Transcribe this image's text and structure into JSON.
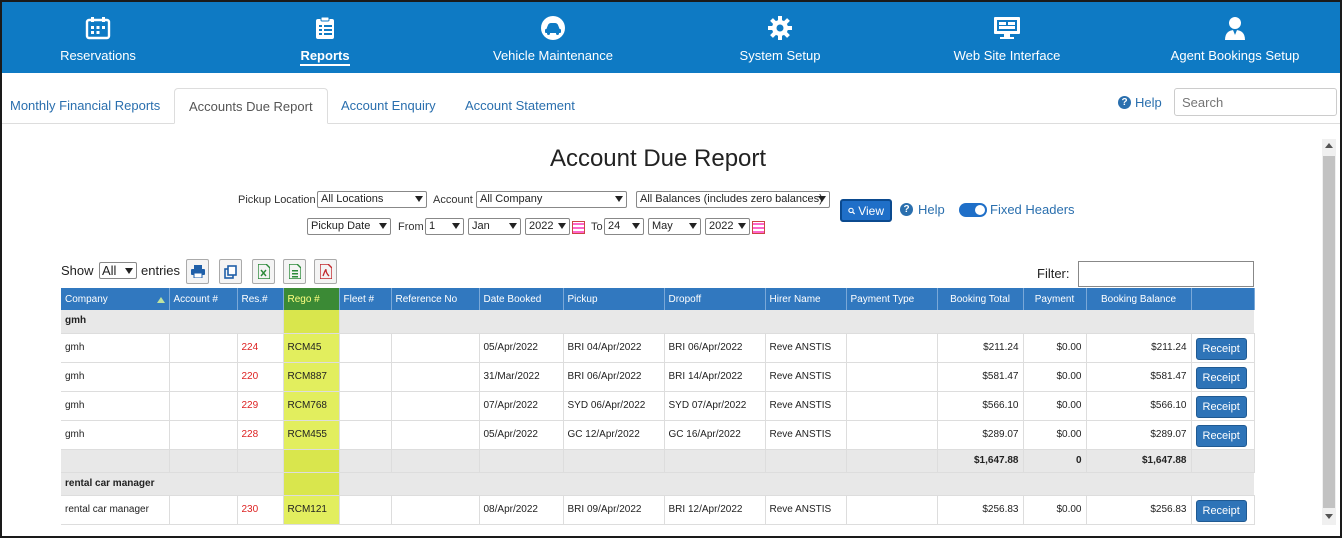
{
  "nav": {
    "items": [
      {
        "label": "Reservations",
        "icon": "calendar-icon"
      },
      {
        "label": "Reports",
        "icon": "clipboard-icon"
      },
      {
        "label": "Vehicle Maintenance",
        "icon": "car-icon"
      },
      {
        "label": "System Setup",
        "icon": "gear-icon"
      },
      {
        "label": "Web Site Interface",
        "icon": "monitor-icon"
      },
      {
        "label": "Agent Bookings Setup",
        "icon": "agent-icon"
      }
    ]
  },
  "tabs": [
    {
      "label": "Monthly Financial Reports"
    },
    {
      "label": "Accounts Due Report"
    },
    {
      "label": "Account Enquiry"
    },
    {
      "label": "Account Statement"
    }
  ],
  "top_help": "Help",
  "search": {
    "placeholder": "Search"
  },
  "title": "Account Due Report",
  "filters": {
    "pickup_location_label": "Pickup Location",
    "pickup_location": "All Locations",
    "account_label": "Account",
    "account": "All Company",
    "balances": "All Balances (includes zero balances)",
    "date_type": "Pickup Date",
    "from_label": "From",
    "from_day": "1",
    "from_month": "Jan",
    "from_year": "2022",
    "to_label": "To",
    "to_day": "24",
    "to_month": "May",
    "to_year": "2022",
    "view_label": "View",
    "help_label": "Help",
    "fixed_headers_label": "Fixed Headers"
  },
  "table_controls": {
    "show_label": "Show",
    "show_value": "All",
    "entries_label": "entries",
    "filter_label": "Filter:"
  },
  "table": {
    "headers": [
      "Company",
      "Account #",
      "Res.#",
      "Rego #",
      "Fleet #",
      "Reference No",
      "Date Booked",
      "Pickup",
      "Dropoff",
      "Hirer Name",
      "Payment Type",
      "Booking Total",
      "Payment",
      "Booking Balance",
      ""
    ],
    "groups": [
      {
        "name": "gmh",
        "rows": [
          {
            "company": "gmh",
            "account": "",
            "res": "224",
            "rego": "RCM45",
            "fleet": "",
            "ref": "",
            "booked": "05/Apr/2022",
            "pickup": "BRI 04/Apr/2022",
            "dropoff": "BRI 06/Apr/2022",
            "hirer": "Reve ANSTIS",
            "ptype": "",
            "total": "$211.24",
            "payment": "$0.00",
            "balance": "$211.24",
            "action": "Receipt"
          },
          {
            "company": "gmh",
            "account": "",
            "res": "220",
            "rego": "RCM887",
            "fleet": "",
            "ref": "",
            "booked": "31/Mar/2022",
            "pickup": "BRI 06/Apr/2022",
            "dropoff": "BRI 14/Apr/2022",
            "hirer": "Reve ANSTIS",
            "ptype": "",
            "total": "$581.47",
            "payment": "$0.00",
            "balance": "$581.47",
            "action": "Receipt"
          },
          {
            "company": "gmh",
            "account": "",
            "res": "229",
            "rego": "RCM768",
            "fleet": "",
            "ref": "",
            "booked": "07/Apr/2022",
            "pickup": "SYD 06/Apr/2022",
            "dropoff": "SYD 07/Apr/2022",
            "hirer": "Reve ANSTIS",
            "ptype": "",
            "total": "$566.10",
            "payment": "$0.00",
            "balance": "$566.10",
            "action": "Receipt"
          },
          {
            "company": "gmh",
            "account": "",
            "res": "228",
            "rego": "RCM455",
            "fleet": "",
            "ref": "",
            "booked": "05/Apr/2022",
            "pickup": "GC 12/Apr/2022",
            "dropoff": "GC 16/Apr/2022",
            "hirer": "Reve ANSTIS",
            "ptype": "",
            "total": "$289.07",
            "payment": "$0.00",
            "balance": "$289.07",
            "action": "Receipt"
          }
        ],
        "totals": {
          "total": "$1,647.88",
          "payment": "0",
          "balance": "$1,647.88"
        }
      },
      {
        "name": "rental car manager",
        "rows": [
          {
            "company": "rental car manager",
            "account": "",
            "res": "230",
            "rego": "RCM121",
            "fleet": "",
            "ref": "",
            "booked": "08/Apr/2022",
            "pickup": "BRI 09/Apr/2022",
            "dropoff": "BRI 12/Apr/2022",
            "hirer": "Reve ANSTIS",
            "ptype": "",
            "total": "$256.83",
            "payment": "$0.00",
            "balance": "$256.83",
            "action": "Receipt"
          }
        ]
      }
    ]
  }
}
